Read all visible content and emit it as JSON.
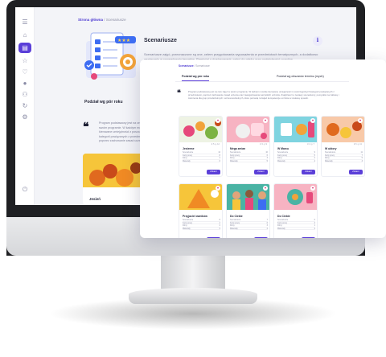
{
  "colors": {
    "accent": "#5b3fd8",
    "heart": "#d83a7c",
    "background": "#f3f4f8"
  },
  "sidebar": {
    "items": [
      {
        "icon": "menu-icon"
      },
      {
        "icon": "home-icon"
      },
      {
        "icon": "scenario-icon",
        "active": true
      },
      {
        "icon": "star-icon"
      },
      {
        "icon": "heart-icon"
      },
      {
        "icon": "user-icon"
      },
      {
        "icon": "group-icon"
      },
      {
        "icon": "refresh-icon"
      },
      {
        "icon": "settings-icon"
      },
      {
        "icon": "logout-icon"
      }
    ]
  },
  "back": {
    "breadcrumb": {
      "home": "Strona główna",
      "sep": "/",
      "current": "Scenariusze"
    },
    "title": "Scenariusze",
    "description": "Scenariusze zajęć, przeznaczone są one, celem przygotowania wyposażenia w przedmiotach tematycznych, a dodatkowo wspieraniu w prowadzeniu tematów. Pamiętaj o dostosowaniu zajęć do wieku oraz umiejętności uczniów.",
    "section_title": "Podział wg pór roku",
    "quote": "Program podstawowy jest na celu zajęć w swoim programie. W każdym module kierowane umiejętności z poszczególnych kategorii powiązanych z przedmiotami poprzez zachowanie zasad uczenia pracy",
    "card_title": "Jesień"
  },
  "panel": {
    "breadcrumb": {
      "home": "Scenariusze",
      "sep": "/",
      "current": "Scenariusze"
    },
    "tabs": [
      {
        "label": "Podział wg pór roku",
        "active": true
      },
      {
        "label": "Podział wg obszarów terminu (mych)"
      }
    ],
    "quote": "Program podstawowy jest na celu zajęć w swoim programie. W każdym module kierowane umiejętności z poszczególnych kategorii powiązanych z przedmiotami, poprzez zachowanie zasad uczenia oraz zaangażowania wszystkich uczniów. Znajdziesz tu zestawy scenariuszy, pomysłów na zabawy i ćwiczenia dla grup przedszkolnych i wczesnoszkolnych, które pozwolą rozwijać kompetencje uczniów w ciekawy sposób.",
    "cards": [
      {
        "title": "Jesienne",
        "button": "Zobacz",
        "stats": "♥ 5   ◎ 12",
        "rows": [
          [
            "Scenariusze",
            "12"
          ],
          [
            "Karty pracy",
            "8"
          ],
          [
            "Filmy",
            "4"
          ],
          [
            "Materiały",
            "6"
          ]
        ]
      },
      {
        "title": "Mega zmian",
        "button": "Zobacz",
        "stats": "♥ 3   ◎ 9",
        "rows": [
          [
            "Scenariusze",
            "10"
          ],
          [
            "Karty pracy",
            "6"
          ],
          [
            "Filmy",
            "3"
          ],
          [
            "Materiały",
            "5"
          ]
        ]
      },
      {
        "title": "W Marcu",
        "button": "Zobacz",
        "stats": "♥ 4   ◎ 7",
        "rows": [
          [
            "Scenariusze",
            "9"
          ],
          [
            "Karty pracy",
            "5"
          ],
          [
            "Filmy",
            "2"
          ],
          [
            "Materiały",
            "4"
          ]
        ]
      },
      {
        "title": "W ubiory",
        "button": "Zobacz",
        "stats": "♥ 6   ◎ 11",
        "rows": [
          [
            "Scenariusze",
            "11"
          ],
          [
            "Karty pracy",
            "7"
          ],
          [
            "Filmy",
            "5"
          ],
          [
            "Materiały",
            "3"
          ]
        ]
      },
      {
        "title": "Przyjaciel owników",
        "button": "Zobacz",
        "stats": "",
        "rows": [
          [
            "Scenariusze",
            "8"
          ],
          [
            "Karty pracy",
            "4"
          ],
          [
            "Filmy",
            "2"
          ],
          [
            "Materiały",
            "3"
          ]
        ]
      },
      {
        "title": "Do Ciebie",
        "button": "Zobacz",
        "stats": "",
        "rows": [
          [
            "Scenariusze",
            "7"
          ],
          [
            "Karty pracy",
            "6"
          ],
          [
            "Filmy",
            "3"
          ],
          [
            "Materiały",
            "2"
          ]
        ]
      },
      {
        "title": "Do Ciebie",
        "button": "Zobacz",
        "stats": "",
        "rows": [
          [
            "Scenariusze",
            "6"
          ],
          [
            "Karty pracy",
            "3"
          ],
          [
            "Filmy",
            "1"
          ],
          [
            "Materiały",
            "4"
          ]
        ]
      }
    ]
  }
}
